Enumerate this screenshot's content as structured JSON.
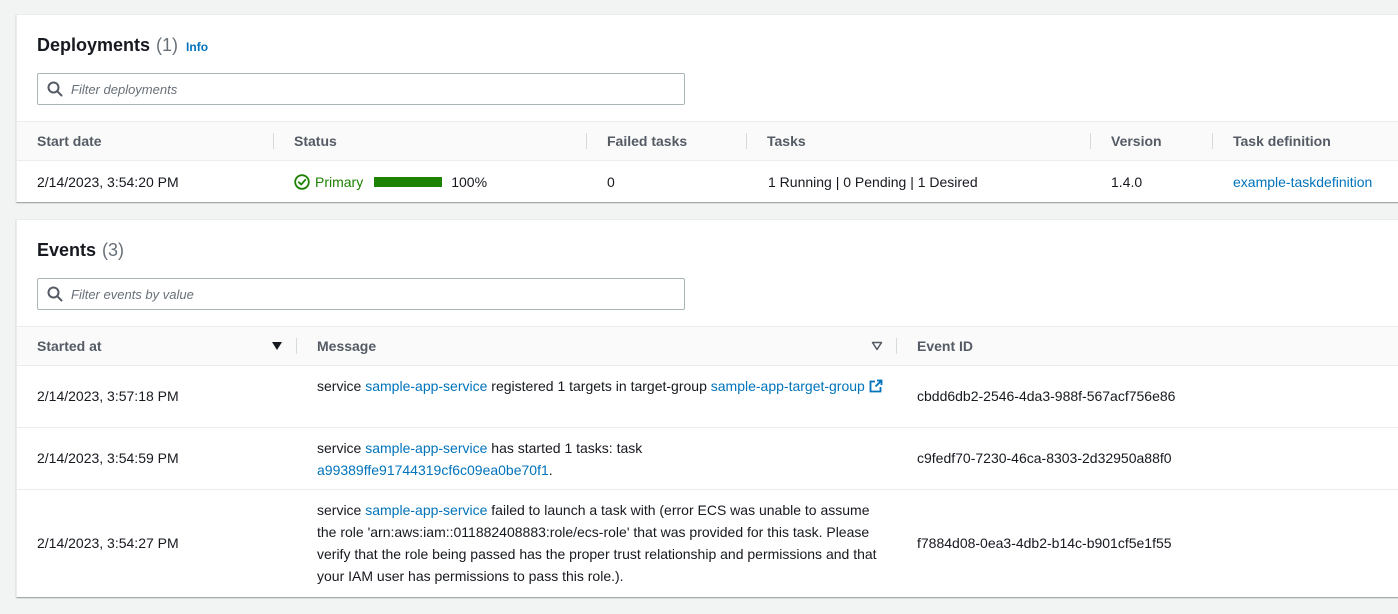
{
  "deployments": {
    "title": "Deployments",
    "count": "(1)",
    "info_label": "Info",
    "filter_placeholder": "Filter deployments",
    "columns": [
      "Start date",
      "Status",
      "Failed tasks",
      "Tasks",
      "Version",
      "Task definition"
    ],
    "rows": [
      {
        "start_date": "2/14/2023, 3:54:20 PM",
        "status": "Primary",
        "progress_value": 1.0,
        "progress_label": "100%",
        "failed_tasks": "0",
        "tasks": "1 Running | 0 Pending | 1 Desired",
        "version": "1.4.0",
        "task_definition": "example-taskdefinition"
      }
    ]
  },
  "events": {
    "title": "Events",
    "count": "(3)",
    "filter_placeholder": "Filter events by value",
    "columns": [
      "Started at",
      "Message",
      "Event ID"
    ],
    "rows": [
      {
        "started_at": "2/14/2023, 3:57:18 PM",
        "msg_prefix": "service ",
        "msg_service": "sample-app-service",
        "msg_mid": " registered 1 targets in target-group ",
        "msg_link": "sample-app-target-group",
        "msg_suffix": "",
        "event_id": "cbdd6db2-2546-4da3-988f-567acf756e86"
      },
      {
        "started_at": "2/14/2023, 3:54:59 PM",
        "msg_prefix": "service ",
        "msg_service": "sample-app-service",
        "msg_mid": " has started 1 tasks: task ",
        "msg_link": "a99389ffe91744319cf6c09ea0be70f1",
        "msg_suffix": ".",
        "event_id": "c9fedf70-7230-46ca-8303-2d32950a88f0"
      },
      {
        "started_at": "2/14/2023, 3:54:27 PM",
        "msg_prefix": "service ",
        "msg_service": "sample-app-service",
        "msg_mid": " failed to launch a task with (error ECS was unable to assume the role 'arn:aws:iam::011882408883:role/ecs-role' that was provided for this task. Please verify that the role being passed has the proper trust relationship and permissions and that your IAM user has permissions to pass this role.).",
        "msg_link": "",
        "msg_suffix": "",
        "event_id": "f7884d08-0ea3-4db2-b14c-b901cf5e1f55"
      }
    ]
  },
  "colors": {
    "link": "#0073bb",
    "success": "#1d8102",
    "text": "#16191f",
    "muted": "#687078"
  },
  "icons": {
    "search": "search-icon",
    "status_ok": "check-circle-icon",
    "sort_desc": "caret-down-filled-icon",
    "sort_none": "caret-down-outline-icon",
    "external": "external-link-icon"
  }
}
